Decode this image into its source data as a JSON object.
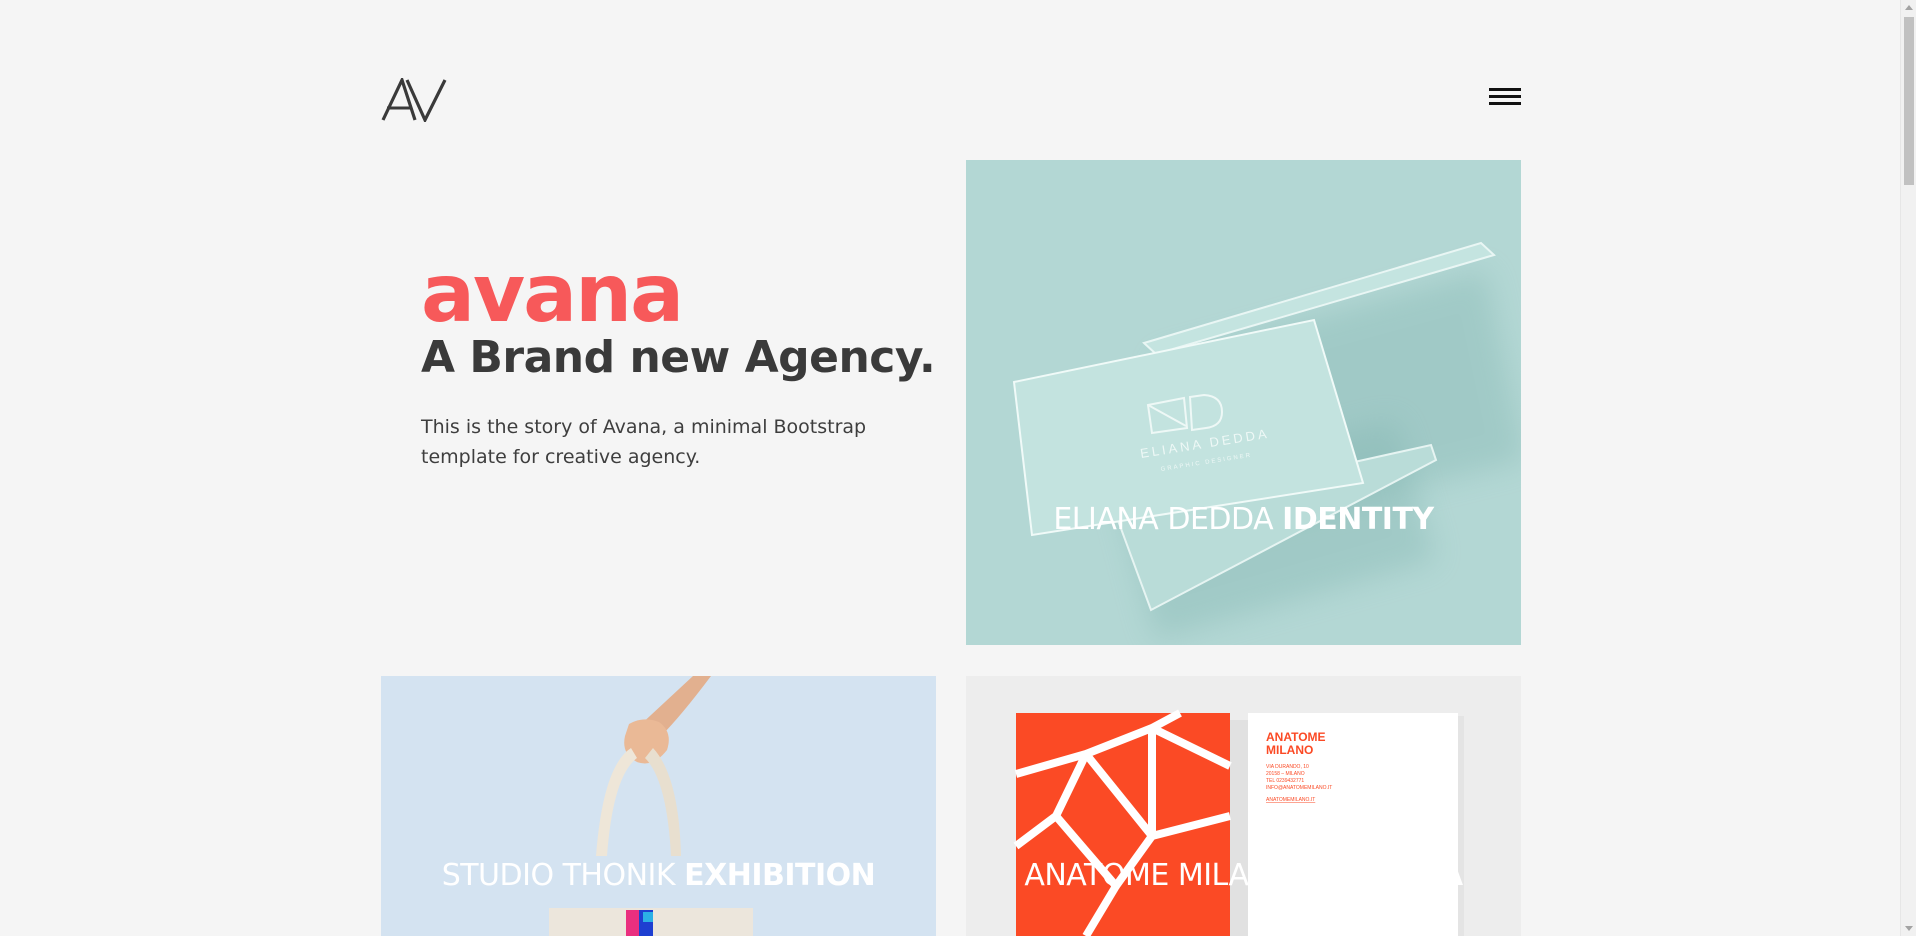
{
  "header": {
    "logo_text": "AV",
    "menu_icon": "hamburger-menu-icon"
  },
  "intro": {
    "brand_name": "avana",
    "tagline": "A Brand new Agency.",
    "description": "This is the story of Avana, a minimal Bootstrap template for creative agency."
  },
  "projects": [
    {
      "client": "ELIANA DEDDA",
      "type": "IDENTITY"
    },
    {
      "client": "STUDIO THONIK",
      "type": "EXHIBITION"
    },
    {
      "client": "ANATOME MILANO",
      "type": "GALLERIA"
    }
  ],
  "artwork": {
    "eliana_card_text": "ELIANA DEDDA",
    "eliana_card_sub": "GRAPHIC DESIGNER",
    "anatome_card_title_line1": "ANATOME",
    "anatome_card_title_line2": "MILANO",
    "anatome_card_address": [
      "VIA DURANDO, 10",
      "20158 – MILANO",
      "TEL 0239432771",
      "INFO@ANATOMEMILANO.IT"
    ],
    "anatome_card_web": "ANATOMEMILANO.IT"
  },
  "colors": {
    "accent": "#f7595a",
    "text_dark": "#3a3a3a",
    "background": "#f5f5f5",
    "tile_mint": "#b3d7d4",
    "tile_blue": "#d4e3f1",
    "tile_grey": "#ededed"
  }
}
